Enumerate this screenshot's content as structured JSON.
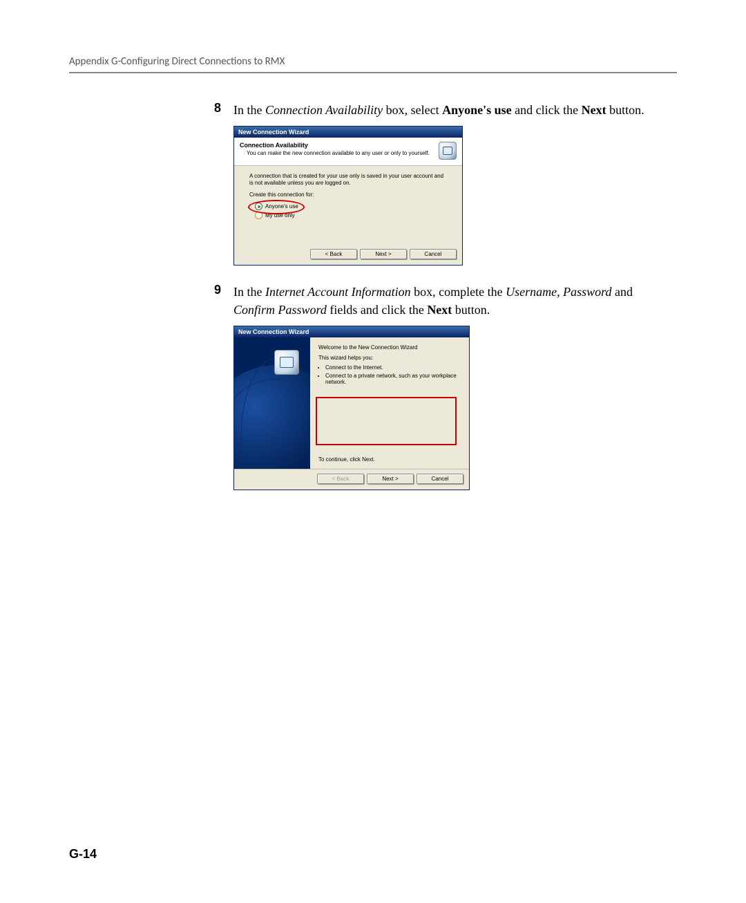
{
  "header": "Appendix G-Configuring Direct Connections to RMX",
  "step8": {
    "num": "8",
    "t1": "In the ",
    "i1": "Connection Availability",
    "t2": " box, select ",
    "b1": "Anyone's use",
    "t3": " and click the ",
    "b2": "Next",
    "t4": " button."
  },
  "dlg1": {
    "title": "New Connection Wizard",
    "heading": "Connection Availability",
    "sub": "You can make the new connection available to any user or only to yourself.",
    "body_text": "A connection that is created for your use only is saved in your user account and is not available unless you are logged on.",
    "create_label": "Create this connection for:",
    "opt1": "Anyone's use",
    "opt2": "My use only",
    "back": "< Back",
    "next": "Next >",
    "cancel": "Cancel"
  },
  "step9": {
    "num": "9",
    "t1": "In the ",
    "i1": "Internet Account Information",
    "t2": " box, complete the ",
    "i2": "Username",
    "t3": ", ",
    "i3": "Password",
    "t4": " and ",
    "i4": "Confirm Password",
    "t5": " fields and click the ",
    "b1": "Next",
    "t6": " button."
  },
  "dlg2": {
    "title": "New Connection Wizard",
    "heading": "Welcome to the New Connection Wizard",
    "helps": "This wizard helps you:",
    "bul1": "Connect to the Internet.",
    "bul2": "Connect to a private network, such as your workplace network.",
    "continue": "To continue, click Next.",
    "back": "< Back",
    "next": "Next >",
    "cancel": "Cancel"
  },
  "page_num": "G-14"
}
